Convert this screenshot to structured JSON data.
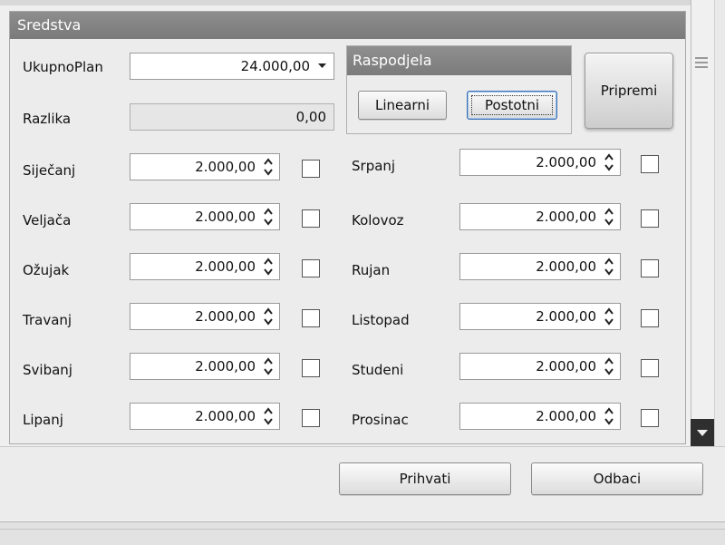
{
  "group": {
    "title": "Sredstva"
  },
  "plan": {
    "label": "UkupnoPlan",
    "value": "24.000,00"
  },
  "razlika": {
    "label": "Razlika",
    "value": "0,00"
  },
  "raspodjela": {
    "title": "Raspodjela",
    "linear_label": "Linearni",
    "percent_label": "Postotni"
  },
  "pripremi_label": "Pripremi",
  "months_left": [
    {
      "name": "Siječanj",
      "value": "2.000,00"
    },
    {
      "name": "Veljača",
      "value": "2.000,00"
    },
    {
      "name": "Ožujak",
      "value": "2.000,00"
    },
    {
      "name": "Travanj",
      "value": "2.000,00"
    },
    {
      "name": "Svibanj",
      "value": "2.000,00"
    },
    {
      "name": "Lipanj",
      "value": "2.000,00"
    }
  ],
  "months_right": [
    {
      "name": "Srpanj",
      "value": "2.000,00"
    },
    {
      "name": "Kolovoz",
      "value": "2.000,00"
    },
    {
      "name": "Rujan",
      "value": "2.000,00"
    },
    {
      "name": "Listopad",
      "value": "2.000,00"
    },
    {
      "name": "Studeni",
      "value": "2.000,00"
    },
    {
      "name": "Prosinac",
      "value": "2.000,00"
    }
  ],
  "footer": {
    "accept_label": "Prihvati",
    "reject_label": "Odbaci"
  },
  "colors": {
    "title_bar": "#808080",
    "focus_border": "#3d6fb3"
  }
}
